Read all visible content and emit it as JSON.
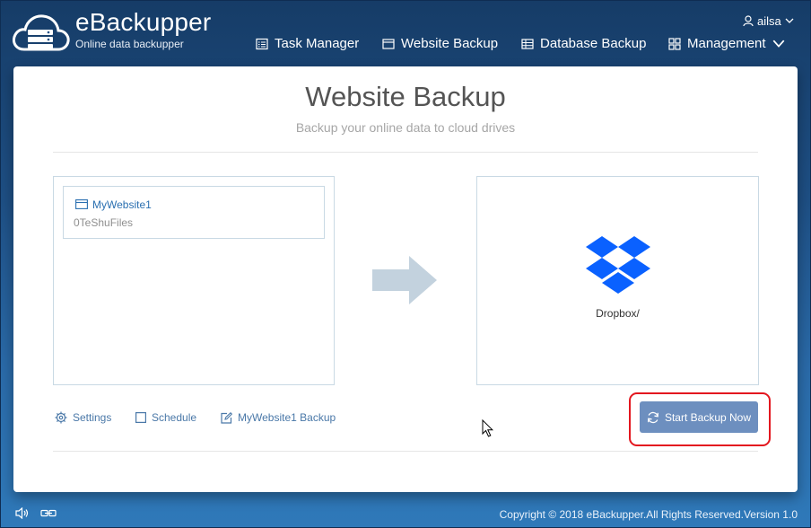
{
  "brand": {
    "title": "eBackupper",
    "subtitle": "Online data backupper"
  },
  "user": {
    "name": "ailsa"
  },
  "nav": [
    {
      "label": "Task Manager",
      "icon": "task-list-icon"
    },
    {
      "label": "Website Backup",
      "icon": "browser-window-icon"
    },
    {
      "label": "Database Backup",
      "icon": "database-table-icon"
    },
    {
      "label": "Management",
      "icon": "grid-icon"
    }
  ],
  "page": {
    "title": "Website Backup",
    "subtitle": "Backup your online data to cloud drives"
  },
  "source": {
    "name": "MyWebsite1",
    "folder": "0TeShuFiles"
  },
  "destination": {
    "label": "Dropbox/",
    "icon": "dropbox-logo"
  },
  "actions": {
    "settings": "Settings",
    "schedule": "Schedule",
    "task_name": "MyWebsite1 Backup",
    "start": "Start Backup Now"
  },
  "footer": {
    "copyright": "Copyright © 2018 eBackupper.All Rights Reserved.Version 1.0"
  },
  "colors": {
    "header_bg": "#1e4f84",
    "accent_button": "#6d8fbf",
    "highlight": "#e3171f",
    "link": "#4a78a8",
    "dropbox_blue": "#0a61ff"
  }
}
